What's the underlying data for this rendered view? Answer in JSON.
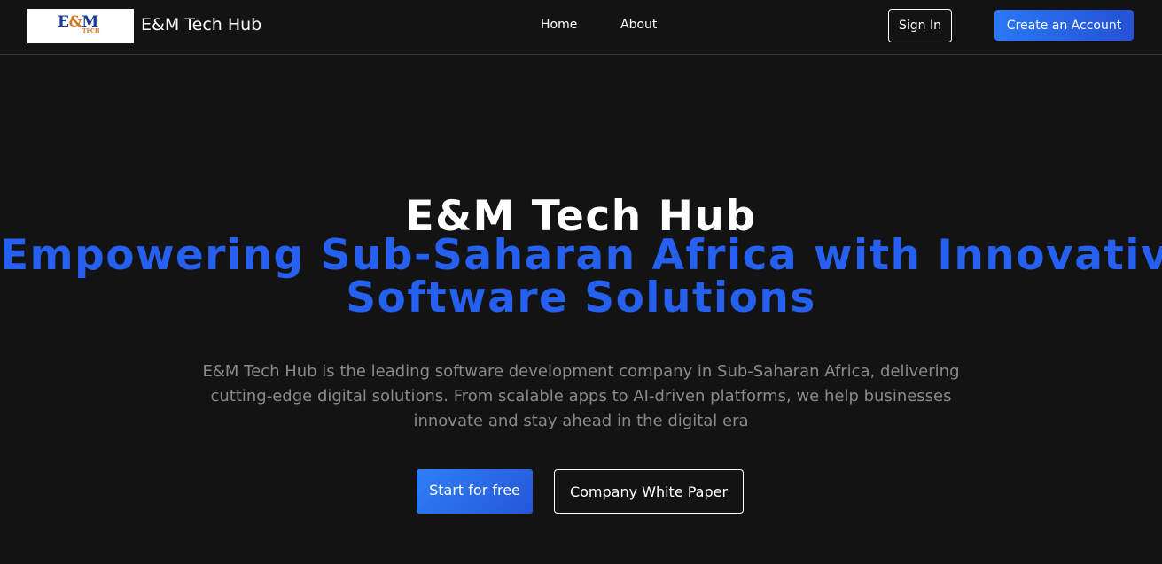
{
  "navbar": {
    "logo": {
      "em_text": "E",
      "amp_text": "&",
      "m_text": "M",
      "sub_text": "TECH"
    },
    "brand_name": "E&M Tech Hub",
    "links": [
      {
        "label": "Home"
      },
      {
        "label": "About"
      }
    ],
    "signin_label": "Sign In",
    "create_account_label": "Create an Account"
  },
  "hero": {
    "title": "E&M Tech Hub",
    "tagline_lines": [
      "Empowering Sub-Saharan Africa with Innovative",
      "Software Solutions"
    ],
    "description_lines": [
      "E&M Tech Hub is the leading software development company in Sub-Saharan Africa, delivering",
      "cutting-edge digital solutions. From scalable apps to AI-driven platforms, we help businesses",
      "innovate and stay ahead in the digital era"
    ],
    "start_label": "Start for free",
    "whitepaper_label": "Company White Paper"
  },
  "colors": {
    "background": "#131313",
    "accent": "#2560f0",
    "muted_text": "#8a8a8a"
  }
}
